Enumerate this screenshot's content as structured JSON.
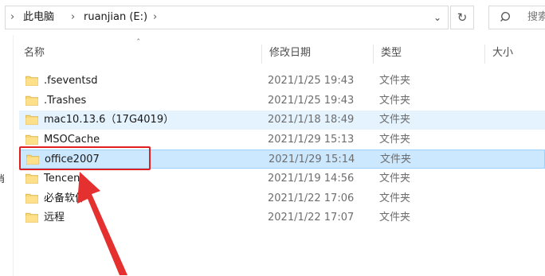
{
  "address_bar": {
    "left_edge_text": "‹",
    "breadcrumb": [
      "此电脑",
      "ruanjian (E:)"
    ]
  },
  "search": {
    "placeholder": "搜索"
  },
  "nav_pane": {
    "partial_label": "消"
  },
  "columns": {
    "name": "名称",
    "date": "修改日期",
    "type": "类型",
    "size": "大小"
  },
  "rows": [
    {
      "name": ".fseventsd",
      "date": "2021/1/25 19:43",
      "type": "文件夹"
    },
    {
      "name": ".Trashes",
      "date": "2021/1/25 19:43",
      "type": "文件夹"
    },
    {
      "name": "mac10.13.6（17G4019）",
      "date": "2021/1/18 18:49",
      "type": "文件夹"
    },
    {
      "name": "MSOCache",
      "date": "2021/1/29 15:13",
      "type": "文件夹"
    },
    {
      "name": "office2007",
      "date": "2021/1/29 15:14",
      "type": "文件夹"
    },
    {
      "name": "Tencent",
      "date": "2021/1/19 14:56",
      "type": "文件夹"
    },
    {
      "name": "必备软件",
      "date": "2021/1/22 17:06",
      "type": "文件夹"
    },
    {
      "name": "远程",
      "date": "2021/1/22 17:07",
      "type": "文件夹"
    }
  ],
  "colors": {
    "folder_yellow": "#f8d775",
    "selection_bg": "#cce8ff",
    "annotation_red": "#e02020"
  }
}
